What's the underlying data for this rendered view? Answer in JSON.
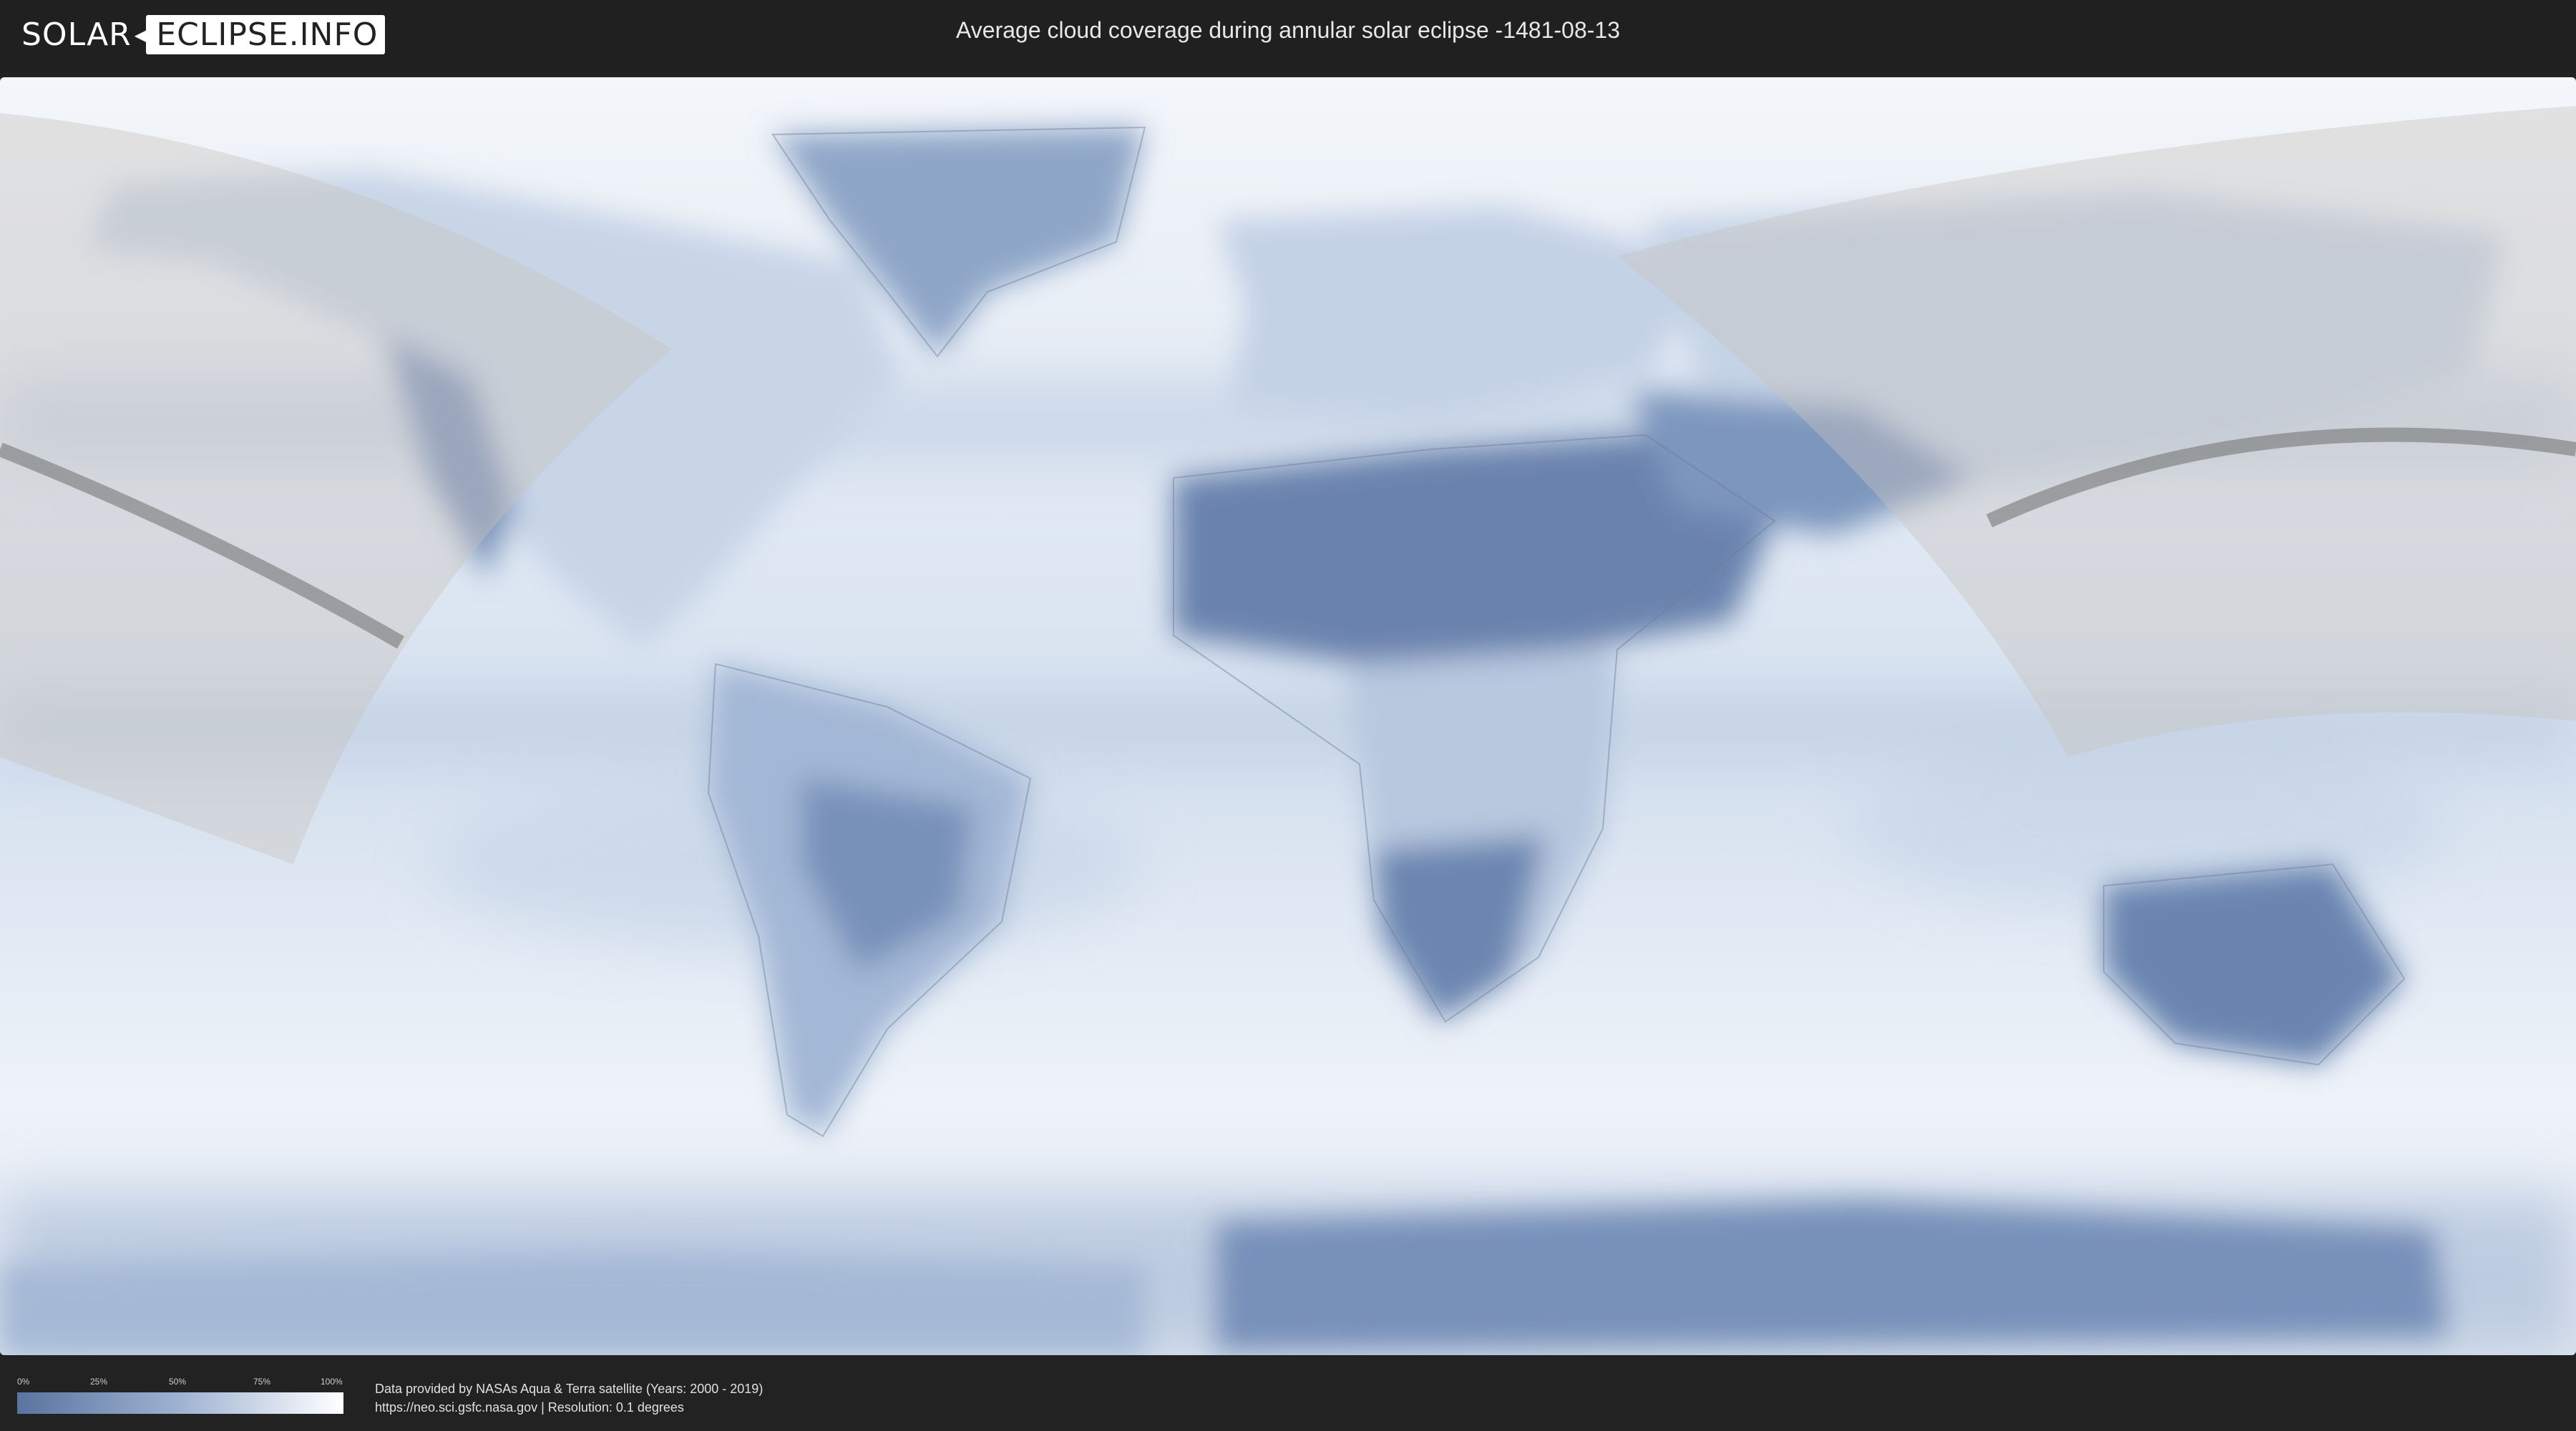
{
  "header": {
    "logo_solar": "SOLAR",
    "logo_eclipse": "ECLIPSE.INFO",
    "title": "Average cloud coverage during annular solar eclipse -1481-08-13"
  },
  "map": {
    "colors": {
      "ocean_clear": "#e9f0f8",
      "cloud_dense": "#5a74a0",
      "cloud_medium": "#8ea6c8",
      "land_outline": "#6b7d96",
      "night_shade": "#c9c4be",
      "eclipse_path": "#6e6e6e"
    }
  },
  "legend": {
    "ticks": [
      "0%",
      "25%",
      "50%",
      "75%",
      "100%"
    ],
    "gradient": [
      "#5a74a0",
      "#9fb3d2",
      "#ffffff"
    ]
  },
  "credit": {
    "line1": "Data provided by NASAs Aqua & Terra satellite (Years: 2000 - 2019)",
    "line2": "https://neo.sci.gsfc.nasa.gov | Resolution: 0.1 degrees"
  }
}
